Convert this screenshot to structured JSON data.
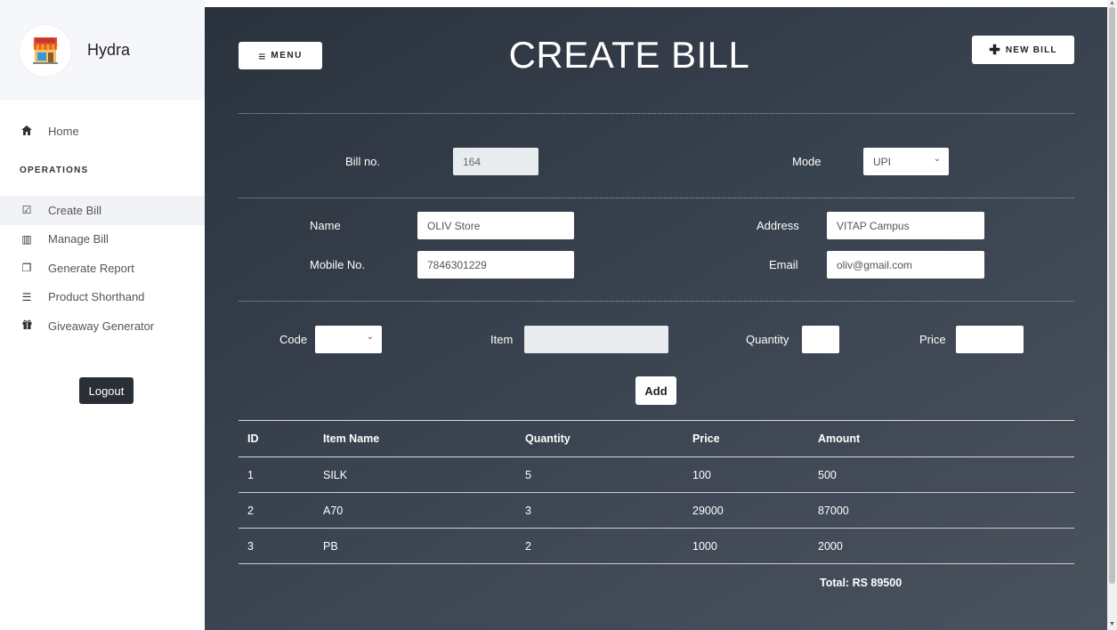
{
  "sidebar": {
    "brand": "Hydra",
    "home_label": "Home",
    "section_label": "OPERATIONS",
    "items": [
      {
        "label": "Create Bill",
        "icon": "edit-icon",
        "glyph": "☑"
      },
      {
        "label": "Manage Bill",
        "icon": "bar-chart-icon",
        "glyph": "▥"
      },
      {
        "label": "Generate Report",
        "icon": "clone-icon",
        "glyph": "❐"
      },
      {
        "label": "Product Shorthand",
        "icon": "list-icon",
        "glyph": "☰"
      },
      {
        "label": "Giveaway Generator",
        "icon": "gift-icon",
        "glyph": "🎁"
      }
    ],
    "logout_label": "Logout"
  },
  "header": {
    "menu_label": "MENU",
    "title": "CREATE BILL",
    "new_bill_label": "NEW BILL"
  },
  "bill": {
    "bill_no_label": "Bill no.",
    "bill_no_value": "164",
    "mode_label": "Mode",
    "mode_value": "UPI"
  },
  "customer": {
    "name_label": "Name",
    "name_value": "OLIV Store",
    "address_label": "Address",
    "address_value": "VITAP Campus",
    "mobile_label": "Mobile No.",
    "mobile_value": "7846301229",
    "email_label": "Email",
    "email_value": "oliv@gmail.com"
  },
  "entry": {
    "code_label": "Code",
    "code_value": "",
    "item_label": "Item",
    "item_value": "",
    "quantity_label": "Quantity",
    "quantity_value": "",
    "price_label": "Price",
    "price_value": "",
    "add_label": "Add"
  },
  "table": {
    "headers": [
      "ID",
      "Item Name",
      "Quantity",
      "Price",
      "Amount"
    ],
    "rows": [
      [
        "1",
        "SILK",
        "5",
        "100",
        "500"
      ],
      [
        "2",
        "A70",
        "3",
        "29000",
        "87000"
      ],
      [
        "3",
        "PB",
        "2",
        "1000",
        "2000"
      ]
    ],
    "total": "Total: RS 89500"
  },
  "colors": {
    "accent_dark": "#2a323d",
    "logout_bg": "#2a2f36"
  }
}
